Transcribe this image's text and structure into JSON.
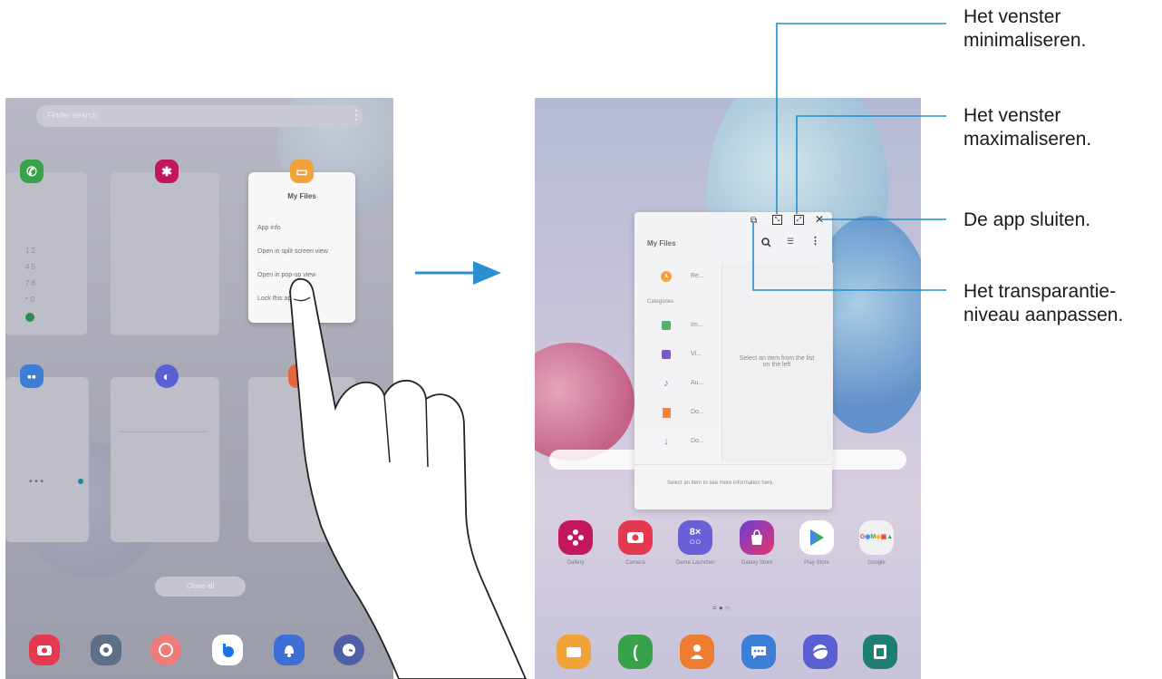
{
  "left_tablet": {
    "search_placeholder": "Finder search",
    "recent_menu": {
      "title": "My Files",
      "items": [
        "App info",
        "Open in split screen view",
        "Open in pop-up view",
        "Lock this app"
      ]
    },
    "close_all_label": "Close all",
    "dock_icons": [
      "camera-icon",
      "settings-icon",
      "ar-emoji-icon",
      "bixby-icon",
      "reminder-icon",
      "clock-icon"
    ]
  },
  "right_tablet": {
    "popup_window": {
      "title": "My Files",
      "recent_label": "Re...",
      "categories_label": "Categories",
      "categories": [
        {
          "icon": "images-icon",
          "label": "Im..."
        },
        {
          "icon": "videos-icon",
          "label": "Vi..."
        },
        {
          "icon": "audio-icon",
          "label": "Au..."
        },
        {
          "icon": "documents-icon",
          "label": "Do..."
        },
        {
          "icon": "downloads-icon",
          "label": "Do..."
        }
      ],
      "detail_text": "Select an item from the list on the left",
      "footer_text": "Select an item to see more information here."
    },
    "apps": [
      {
        "icon": "gallery-icon",
        "label": "Gallery",
        "color": "#c2185b"
      },
      {
        "icon": "camera-icon",
        "label": "Camera",
        "color": "#e53950"
      },
      {
        "icon": "game-launcher-icon",
        "label": "Game Launcher",
        "color": "#6a5fd6"
      },
      {
        "icon": "galaxy-store-icon",
        "label": "Galaxy Store",
        "color": "#d6336c"
      },
      {
        "icon": "play-store-icon",
        "label": "Play Store",
        "color": "#ffffff"
      },
      {
        "icon": "google-folder-icon",
        "label": "Google",
        "color": "#f0f0f0"
      }
    ],
    "dock_icons": [
      "my-files-icon",
      "phone-icon",
      "contacts-icon",
      "messages-icon",
      "internet-icon",
      "gallery-frame-icon"
    ]
  },
  "callouts": {
    "minimize": [
      "Het venster",
      "minimaliseren."
    ],
    "maximize": [
      "Het venster",
      "maximaliseren."
    ],
    "close": [
      "De app sluiten."
    ],
    "transparency": [
      "Het transparantie-",
      "niveau aanpassen."
    ]
  },
  "colors": {
    "callout_line": "#1e8fce",
    "arrow": "#2a8fd0"
  }
}
